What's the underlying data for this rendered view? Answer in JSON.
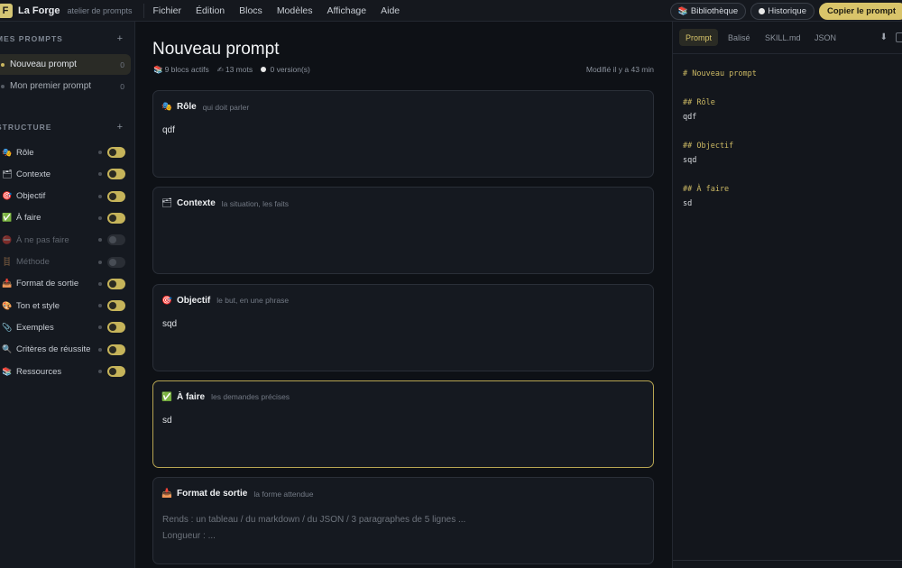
{
  "topbar": {
    "logo_letter": "F",
    "app_name": "La Forge",
    "app_subtitle": "atelier de prompts",
    "menu": [
      "Fichier",
      "Édition",
      "Blocs",
      "Modèles",
      "Affichage",
      "Aide"
    ],
    "library_label": "Bibliothèque",
    "history_label": "Historique",
    "copy_label": "Copier le prompt"
  },
  "sidebar": {
    "prompts_title": "MES PROMPTS",
    "prompts": [
      {
        "label": "Nouveau prompt",
        "count": "0",
        "active": true
      },
      {
        "label": "Mon premier prompt",
        "count": "0",
        "active": false
      }
    ],
    "structure_title": "STRUCTURE",
    "structure": [
      {
        "icon": "🎭",
        "label": "Rôle",
        "on": true
      },
      {
        "icon": "🗂",
        "label": "Contexte",
        "on": true
      },
      {
        "icon": "🎯",
        "label": "Objectif",
        "on": true
      },
      {
        "icon": "✅",
        "label": "À faire",
        "on": true
      },
      {
        "icon": "⛔",
        "label": "À ne pas faire",
        "on": false
      },
      {
        "icon": "🪜",
        "label": "Méthode",
        "on": false
      },
      {
        "icon": "📥",
        "label": "Format de sortie",
        "on": true
      },
      {
        "icon": "🎨",
        "label": "Ton et style",
        "on": true
      },
      {
        "icon": "📎",
        "label": "Exemples",
        "on": true
      },
      {
        "icon": "🔍",
        "label": "Critères de réussite",
        "on": true
      },
      {
        "icon": "📚",
        "label": "Ressources",
        "on": true
      }
    ]
  },
  "main": {
    "title": "Nouveau prompt",
    "meta": {
      "blocks": "9 blocs actifs",
      "words": "13 mots",
      "versions": "0 version(s)"
    },
    "modified": "Modifié il y a 43 min",
    "cards": [
      {
        "icon": "🎭",
        "title": "Rôle",
        "hint": "qui doit parler",
        "value": "qdf",
        "placeholder": ""
      },
      {
        "icon": "🗂",
        "title": "Contexte",
        "hint": "la situation, les faits",
        "value": "",
        "placeholder": ""
      },
      {
        "icon": "🎯",
        "title": "Objectif",
        "hint": "le but, en une phrase",
        "value": "sqd",
        "placeholder": ""
      },
      {
        "icon": "✅",
        "title": "À faire",
        "hint": "les demandes précises",
        "value": "sd",
        "placeholder": ""
      },
      {
        "icon": "📥",
        "title": "Format de sortie",
        "hint": "la forme attendue",
        "value": "",
        "placeholder_line1": "Rends : un tableau / du markdown / du JSON / 3 paragraphes de 5 lignes ...",
        "placeholder_line2": "Longueur : ..."
      }
    ]
  },
  "preview": {
    "tabs": [
      "Prompt",
      "Balisé",
      "SKILL.md",
      "JSON"
    ],
    "active_tab": "Prompt",
    "lines": [
      {
        "kind": "h",
        "text": "# Nouveau prompt"
      },
      {
        "kind": "gap",
        "text": ""
      },
      {
        "kind": "h",
        "text": "## Rôle"
      },
      {
        "kind": "t",
        "text": "qdf"
      },
      {
        "kind": "gap",
        "text": ""
      },
      {
        "kind": "h",
        "text": "## Objectif"
      },
      {
        "kind": "t",
        "text": "sqd"
      },
      {
        "kind": "gap",
        "text": ""
      },
      {
        "kind": "h",
        "text": "## À faire"
      },
      {
        "kind": "t",
        "text": "sd"
      }
    ]
  }
}
